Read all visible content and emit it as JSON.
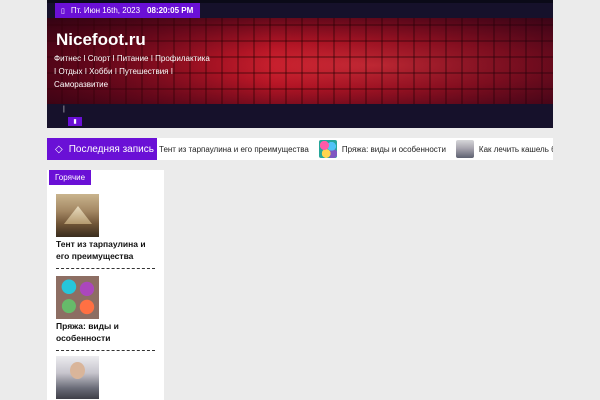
{
  "topbar": {
    "calendar_icon": "calendar-icon",
    "date": "Пт. Июн 16th, 2023",
    "time": "08:20:05 PM"
  },
  "header": {
    "site_title": "Nicefoot.ru",
    "site_description": "Фитнес I Спорт I Питание I Профилактика I Отдых I Хобби I Путешествия I Саморазвитие"
  },
  "navbar": {
    "small_text": "|",
    "menu_icon": "menu-icon"
  },
  "ticker": {
    "label": "Последняя запись",
    "label_icon": "tag-icon",
    "items": [
      {
        "title": "Тент из тарпаулина и его преимущества"
      },
      {
        "title": "Пряжа: виды и особенности"
      },
      {
        "title": "Как лечить кашель без"
      }
    ]
  },
  "sidebar": {
    "tag": "Горячие",
    "posts": [
      {
        "title": "Тент из тарпаулина и его преимущества"
      },
      {
        "title": "Пряжа: виды и особенности"
      },
      {
        "title": ""
      }
    ]
  },
  "colors": {
    "accent": "#6a10d6",
    "dark": "#16112b",
    "hero": "#b81626"
  }
}
